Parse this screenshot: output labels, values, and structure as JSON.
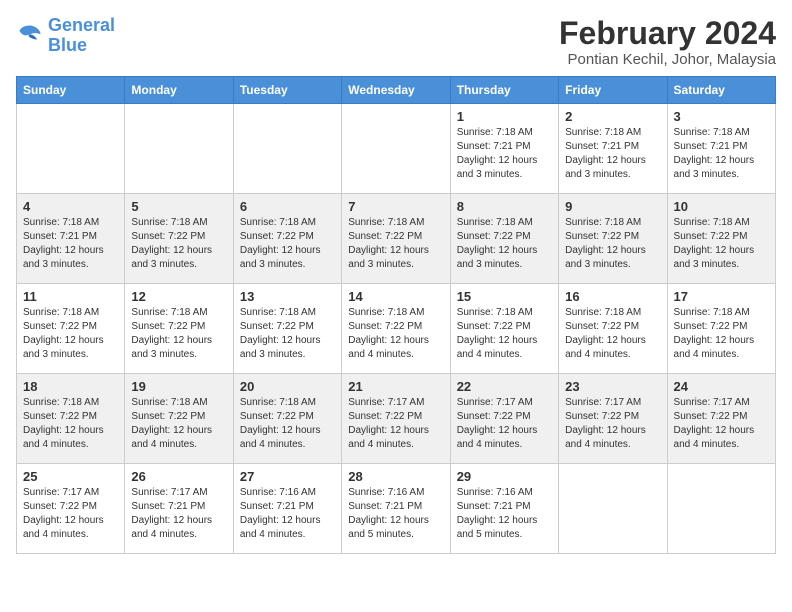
{
  "logo": {
    "line1": "General",
    "line2": "Blue"
  },
  "title": "February 2024",
  "location": "Pontian Kechil, Johor, Malaysia",
  "weekdays": [
    "Sunday",
    "Monday",
    "Tuesday",
    "Wednesday",
    "Thursday",
    "Friday",
    "Saturday"
  ],
  "weeks": [
    [
      {
        "day": "",
        "info": ""
      },
      {
        "day": "",
        "info": ""
      },
      {
        "day": "",
        "info": ""
      },
      {
        "day": "",
        "info": ""
      },
      {
        "day": "1",
        "info": "Sunrise: 7:18 AM\nSunset: 7:21 PM\nDaylight: 12 hours\nand 3 minutes."
      },
      {
        "day": "2",
        "info": "Sunrise: 7:18 AM\nSunset: 7:21 PM\nDaylight: 12 hours\nand 3 minutes."
      },
      {
        "day": "3",
        "info": "Sunrise: 7:18 AM\nSunset: 7:21 PM\nDaylight: 12 hours\nand 3 minutes."
      }
    ],
    [
      {
        "day": "4",
        "info": "Sunrise: 7:18 AM\nSunset: 7:21 PM\nDaylight: 12 hours\nand 3 minutes."
      },
      {
        "day": "5",
        "info": "Sunrise: 7:18 AM\nSunset: 7:22 PM\nDaylight: 12 hours\nand 3 minutes."
      },
      {
        "day": "6",
        "info": "Sunrise: 7:18 AM\nSunset: 7:22 PM\nDaylight: 12 hours\nand 3 minutes."
      },
      {
        "day": "7",
        "info": "Sunrise: 7:18 AM\nSunset: 7:22 PM\nDaylight: 12 hours\nand 3 minutes."
      },
      {
        "day": "8",
        "info": "Sunrise: 7:18 AM\nSunset: 7:22 PM\nDaylight: 12 hours\nand 3 minutes."
      },
      {
        "day": "9",
        "info": "Sunrise: 7:18 AM\nSunset: 7:22 PM\nDaylight: 12 hours\nand 3 minutes."
      },
      {
        "day": "10",
        "info": "Sunrise: 7:18 AM\nSunset: 7:22 PM\nDaylight: 12 hours\nand 3 minutes."
      }
    ],
    [
      {
        "day": "11",
        "info": "Sunrise: 7:18 AM\nSunset: 7:22 PM\nDaylight: 12 hours\nand 3 minutes."
      },
      {
        "day": "12",
        "info": "Sunrise: 7:18 AM\nSunset: 7:22 PM\nDaylight: 12 hours\nand 3 minutes."
      },
      {
        "day": "13",
        "info": "Sunrise: 7:18 AM\nSunset: 7:22 PM\nDaylight: 12 hours\nand 3 minutes."
      },
      {
        "day": "14",
        "info": "Sunrise: 7:18 AM\nSunset: 7:22 PM\nDaylight: 12 hours\nand 4 minutes."
      },
      {
        "day": "15",
        "info": "Sunrise: 7:18 AM\nSunset: 7:22 PM\nDaylight: 12 hours\nand 4 minutes."
      },
      {
        "day": "16",
        "info": "Sunrise: 7:18 AM\nSunset: 7:22 PM\nDaylight: 12 hours\nand 4 minutes."
      },
      {
        "day": "17",
        "info": "Sunrise: 7:18 AM\nSunset: 7:22 PM\nDaylight: 12 hours\nand 4 minutes."
      }
    ],
    [
      {
        "day": "18",
        "info": "Sunrise: 7:18 AM\nSunset: 7:22 PM\nDaylight: 12 hours\nand 4 minutes."
      },
      {
        "day": "19",
        "info": "Sunrise: 7:18 AM\nSunset: 7:22 PM\nDaylight: 12 hours\nand 4 minutes."
      },
      {
        "day": "20",
        "info": "Sunrise: 7:18 AM\nSunset: 7:22 PM\nDaylight: 12 hours\nand 4 minutes."
      },
      {
        "day": "21",
        "info": "Sunrise: 7:17 AM\nSunset: 7:22 PM\nDaylight: 12 hours\nand 4 minutes."
      },
      {
        "day": "22",
        "info": "Sunrise: 7:17 AM\nSunset: 7:22 PM\nDaylight: 12 hours\nand 4 minutes."
      },
      {
        "day": "23",
        "info": "Sunrise: 7:17 AM\nSunset: 7:22 PM\nDaylight: 12 hours\nand 4 minutes."
      },
      {
        "day": "24",
        "info": "Sunrise: 7:17 AM\nSunset: 7:22 PM\nDaylight: 12 hours\nand 4 minutes."
      }
    ],
    [
      {
        "day": "25",
        "info": "Sunrise: 7:17 AM\nSunset: 7:22 PM\nDaylight: 12 hours\nand 4 minutes."
      },
      {
        "day": "26",
        "info": "Sunrise: 7:17 AM\nSunset: 7:21 PM\nDaylight: 12 hours\nand 4 minutes."
      },
      {
        "day": "27",
        "info": "Sunrise: 7:16 AM\nSunset: 7:21 PM\nDaylight: 12 hours\nand 4 minutes."
      },
      {
        "day": "28",
        "info": "Sunrise: 7:16 AM\nSunset: 7:21 PM\nDaylight: 12 hours\nand 5 minutes."
      },
      {
        "day": "29",
        "info": "Sunrise: 7:16 AM\nSunset: 7:21 PM\nDaylight: 12 hours\nand 5 minutes."
      },
      {
        "day": "",
        "info": ""
      },
      {
        "day": "",
        "info": ""
      }
    ]
  ]
}
